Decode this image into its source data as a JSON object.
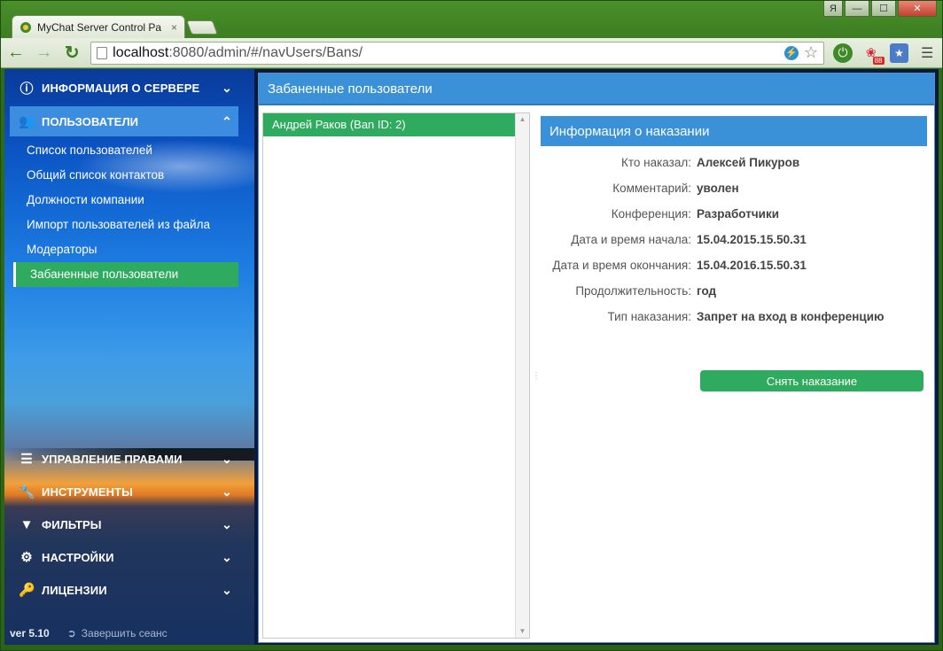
{
  "browser": {
    "tab_title": "MyChat Server Control Pa",
    "tab_close": "×",
    "lang_indicator": "Я",
    "minimize": "—",
    "maximize": "☐",
    "close": "✕",
    "url_host": "localhost",
    "url_path": ":8080/admin/#/navUsers/Bans/",
    "ext_badge": "88"
  },
  "sidebar": {
    "sections_top": [
      {
        "label": "ИНФОРМАЦИЯ О СЕРВЕРЕ",
        "icon": "info-icon",
        "state": "collapsed"
      },
      {
        "label": "ПОЛЬЗОВАТЕЛИ",
        "icon": "users-icon",
        "state": "expanded"
      }
    ],
    "submenu": [
      {
        "label": "Список пользователей"
      },
      {
        "label": "Общий список контактов"
      },
      {
        "label": "Должности компании"
      },
      {
        "label": "Импорт пользователей из файла"
      },
      {
        "label": "Модераторы"
      },
      {
        "label": "Забаненные пользователи",
        "active": true
      }
    ],
    "sections_bottom": [
      {
        "label": "УПРАВЛЕНИЕ ПРАВАМИ",
        "icon": "list-icon"
      },
      {
        "label": "ИНСТРУМЕНТЫ",
        "icon": "wrench-icon"
      },
      {
        "label": "ФИЛЬТРЫ",
        "icon": "filter-icon"
      },
      {
        "label": "НАСТРОЙКИ",
        "icon": "gears-icon"
      },
      {
        "label": "ЛИЦЕНЗИИ",
        "icon": "key-icon"
      }
    ],
    "version": "ver 5.10",
    "logout": "Завершить сеанс"
  },
  "main": {
    "title": "Забаненные пользователи",
    "list": [
      {
        "label": "Андрей Раков (Ban ID: 2)",
        "selected": true
      }
    ],
    "detail": {
      "title": "Информация о наказании",
      "rows": [
        {
          "label": "Кто наказал:",
          "value": "Алексей Пикуров"
        },
        {
          "label": "Комментарий:",
          "value": "уволен"
        },
        {
          "label": "Конференция:",
          "value": "Разработчики"
        },
        {
          "label": "Дата и время начала:",
          "value": "15.04.2015.15.50.31"
        },
        {
          "label": "Дата и время окончания:",
          "value": "15.04.2016.15.50.31"
        },
        {
          "label": "Продолжительность:",
          "value": "год"
        },
        {
          "label": "Тип наказания:",
          "value": "Запрет на вход в конференцию"
        }
      ],
      "unban_button": "Снять наказание"
    }
  },
  "colors": {
    "accent_blue": "#3a91d8",
    "active_green": "#2fab5f"
  }
}
